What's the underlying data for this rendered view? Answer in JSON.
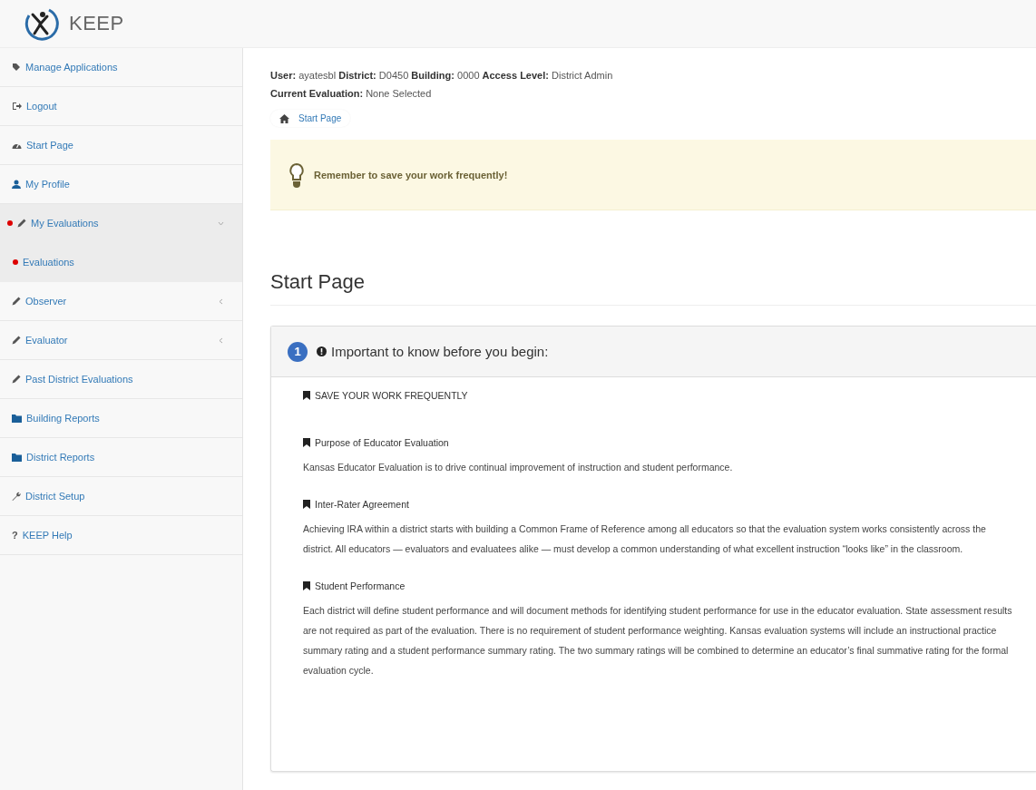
{
  "header": {
    "app_name": "KEEP"
  },
  "sidebar": {
    "items": [
      {
        "label": "Manage Applications",
        "kind": "tag",
        "marked": false,
        "selected": false
      },
      {
        "label": "Logout",
        "kind": "logout",
        "marked": false,
        "selected": false
      },
      {
        "label": "Start Page",
        "kind": "dashboard",
        "marked": false,
        "selected": false
      },
      {
        "label": "My Profile",
        "kind": "user",
        "marked": false,
        "selected": false
      },
      {
        "label": "My Evaluations",
        "kind": "pencil",
        "marked": true,
        "selected": true,
        "expanded": true,
        "children": [
          {
            "label": "Evaluations",
            "marked": true,
            "selected": true
          }
        ]
      },
      {
        "label": "Observer",
        "kind": "pencil",
        "marked": false,
        "selected": false,
        "expanded": false
      },
      {
        "label": "Evaluator",
        "kind": "pencil",
        "marked": false,
        "selected": false,
        "expanded": false
      },
      {
        "label": "Past District Evaluations",
        "kind": "pencil",
        "marked": false,
        "selected": false
      },
      {
        "label": "Building Reports",
        "kind": "folder",
        "marked": false,
        "selected": false
      },
      {
        "label": "District Reports",
        "kind": "folder",
        "marked": false,
        "selected": false
      },
      {
        "label": "District Setup",
        "kind": "wrench",
        "marked": false,
        "selected": false
      },
      {
        "label": "KEEP Help",
        "kind": "help",
        "icon": "?",
        "marked": false,
        "selected": false
      }
    ]
  },
  "info": [
    "**User:** ayatesbl **District:** D0450 **Building:** 0000 **Access Level:** District Admin",
    "**Current Evaluation:** None Selected"
  ],
  "breadcrumb": [
    "Start Page"
  ],
  "alert": {
    "text": "Remember to save your work frequently!"
  },
  "page_title": "Start Page",
  "panel": {
    "step": "1",
    "title": "Important to know before you begin:",
    "sections": [
      {
        "heading": "SAVE YOUR WORK FREQUENTLY"
      },
      {
        "heading": "Purpose of Educator Evaluation",
        "text": "Kansas Educator Evaluation is to drive continual improvement of instruction and student performance."
      },
      {
        "heading": "Inter-Rater Agreement",
        "text": "Achieving IRA within a district starts with building a Common Frame of Reference among all educators so that the evaluation system works consistently across the district. All educators — evaluators and evaluatees alike — must develop a common understanding of what excellent instruction “looks like” in the classroom."
      },
      {
        "heading": "Student Performance",
        "text": "Each district will define student performance and will document methods for identifying student performance for use in the educator evaluation. State assessment results are not required as part of the evaluation. There is no requirement of student performance weighting. Kansas evaluation systems will include an instructional practice summary rating and a student performance summary rating. The two summary ratings will be combined to determine an educator’s final summative rating for the formal evaluation cycle."
      }
    ]
  }
}
